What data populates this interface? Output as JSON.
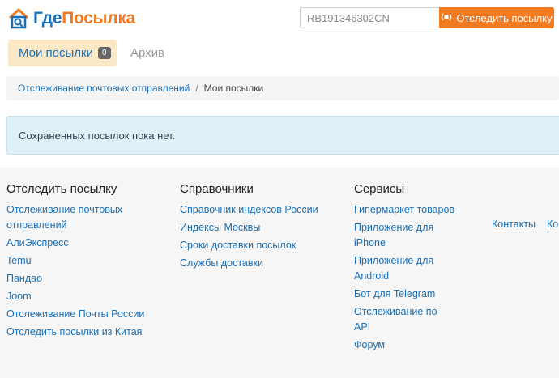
{
  "header": {
    "logo_part1": "Где",
    "logo_part2": "Посылка",
    "search_value": "RB191346302CN",
    "track_button_label": "Отследить посылку"
  },
  "tabs": {
    "active_label": "Мои посылки",
    "active_count": "0",
    "archive_label": "Архив"
  },
  "breadcrumb": {
    "link": "Отслеживание почтовых отправлений",
    "separator": "/",
    "current": "Мои посылки"
  },
  "alert": {
    "message": "Сохраненных посылок пока нет."
  },
  "footer": {
    "col1": {
      "title": "Отследить посылку",
      "items": [
        "Отслеживание почтовых отправлений",
        "АлиЭкспресс",
        "Temu",
        "Пандао",
        "Joom",
        "Отслеживание Почты России",
        "Отследить посылки из Китая"
      ]
    },
    "col2": {
      "title": "Справочники",
      "items": [
        "Справочник индексов России",
        "Индексы Москвы",
        "Сроки доставки посылок",
        "Службы доставки"
      ]
    },
    "col3": {
      "title": "Сервисы",
      "items": [
        "Гипермаркет товаров",
        "Приложение для iPhone",
        "Приложение для Android",
        "Бот для Telegram",
        "Отслеживание по API",
        "Форум"
      ]
    },
    "extra_links": [
      "Контакты",
      "Ко"
    ]
  },
  "colors": {
    "brand_blue": "#1a6fb5",
    "brand_orange": "#f47a20",
    "tab_active_bg": "#fbe8c6",
    "alert_bg": "#dff1f8"
  },
  "icons": {
    "logo": "house-magnifier-logo-icon",
    "track": "parcel-radar-icon"
  }
}
